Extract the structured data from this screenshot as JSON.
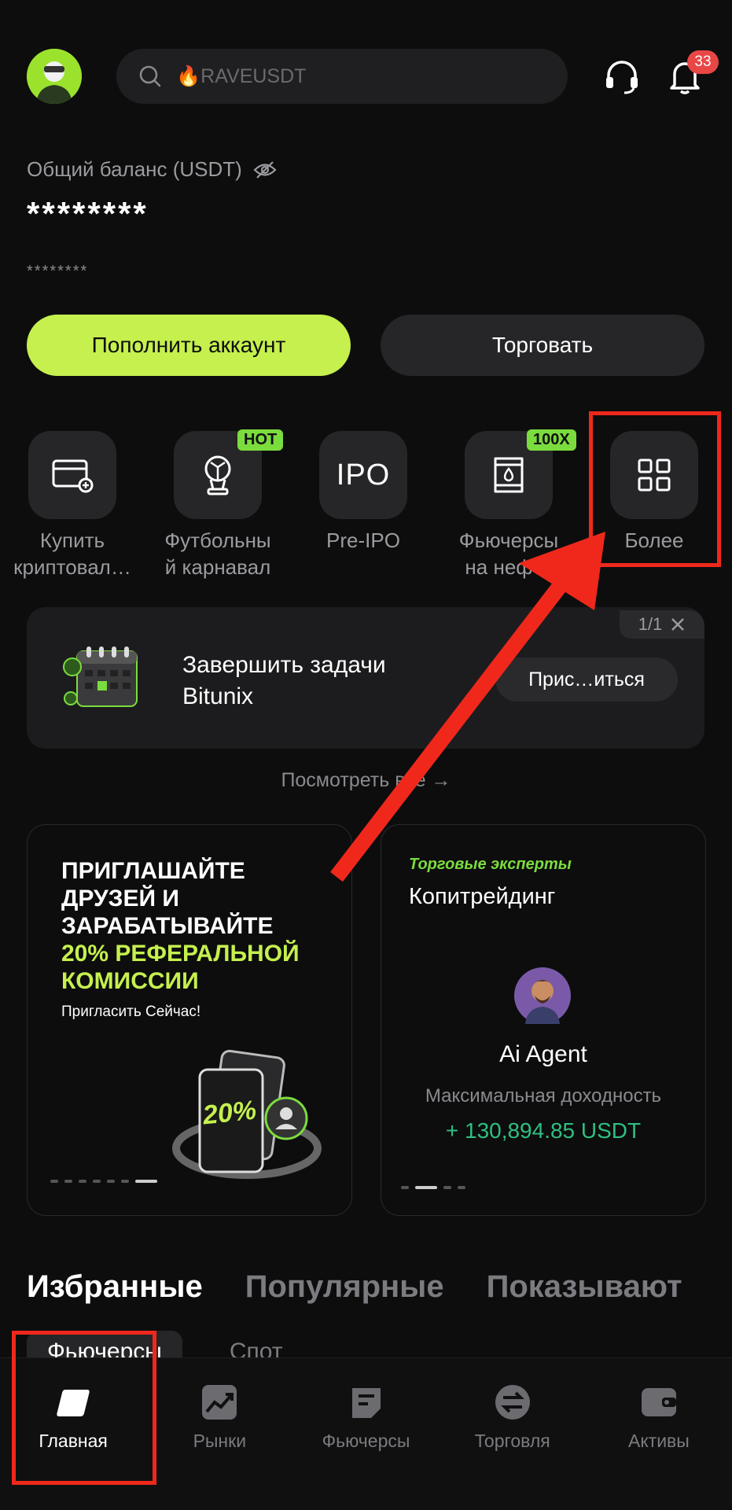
{
  "header": {
    "search_emoji": "🔥",
    "search_placeholder": "RAVEUSDT",
    "notification_count": "33"
  },
  "balance": {
    "label": "Общий баланс (USDT)",
    "value": "********",
    "sub_value": "********"
  },
  "actions": {
    "deposit_label": "Пополнить аккаунт",
    "trade_label": "Торговать"
  },
  "shortcuts": [
    {
      "label": "Купить\nкриптовал…",
      "icon": "card-plus-icon",
      "tag": ""
    },
    {
      "label": "Футбольны\nй карнавал",
      "icon": "trophy-icon",
      "tag": "HOT"
    },
    {
      "label": "Pre-IPO",
      "icon": "ipo-icon",
      "icon_text": "IPO",
      "tag": ""
    },
    {
      "label": "Фьючерсы\nна нефть",
      "icon": "oil-barrel-icon",
      "tag": "100X"
    },
    {
      "label": "Более",
      "icon": "grid-icon",
      "tag": ""
    }
  ],
  "task_card": {
    "title": "Завершить задачи Bitunix",
    "button": "Прис…иться",
    "counter": "1/1"
  },
  "view_all": "Посмотреть все →",
  "promo_referral": {
    "title_line1": "ПРИГЛАШАЙТЕ ДРУЗЕЙ И ЗАРАБАТЫВАЙТЕ",
    "title_line2": "20% РЕФЕРАЛЬНОЙ КОМИССИИ",
    "subtitle": "Пригласить Сейчас!",
    "badge": "20%"
  },
  "promo_copy": {
    "tag": "Торговые эксперты",
    "title": "Копитрейдинг",
    "agent_name": "Ai Agent",
    "yield_label": "Максимальная доходность",
    "yield_value": "+ 130,894.85 USDT"
  },
  "tabs": [
    "Избранные",
    "Популярные",
    "Показывают"
  ],
  "subtabs": [
    "Фьючерсы",
    "Спот"
  ],
  "nav": [
    {
      "label": "Главная",
      "icon": "home-icon",
      "active": true
    },
    {
      "label": "Рынки",
      "icon": "chart-icon",
      "active": false
    },
    {
      "label": "Фьючерсы",
      "icon": "futures-icon",
      "active": false
    },
    {
      "label": "Торговля",
      "icon": "exchange-icon",
      "active": false
    },
    {
      "label": "Активы",
      "icon": "wallet-icon",
      "active": false
    }
  ],
  "colors": {
    "accent": "#c5f04e",
    "highlight": "#f0281c",
    "positive": "#2fbf82"
  }
}
